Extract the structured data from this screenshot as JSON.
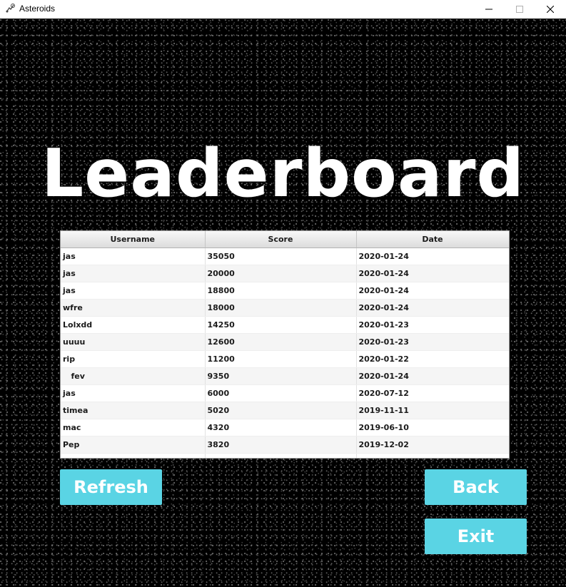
{
  "window": {
    "title": "Asteroids"
  },
  "heading": "Leaderboard",
  "table": {
    "headers": [
      "Username",
      "Score",
      "Date"
    ],
    "rows": [
      [
        "jas",
        "35050",
        "2020-01-24"
      ],
      [
        "jas",
        "20000",
        "2020-01-24"
      ],
      [
        "jas",
        "18800",
        "2020-01-24"
      ],
      [
        "wfre",
        "18000",
        "2020-01-24"
      ],
      [
        "Lolxdd",
        "14250",
        "2020-01-23"
      ],
      [
        "uuuu",
        "12600",
        "2020-01-23"
      ],
      [
        "rip",
        "11200",
        "2020-01-22"
      ],
      [
        "   fev",
        "9350",
        "2020-01-24"
      ],
      [
        "jas",
        "6000",
        "2020-07-12"
      ],
      [
        "timea",
        "5020",
        "2019-11-11"
      ],
      [
        "mac",
        "4320",
        "2019-06-10"
      ],
      [
        "Pep",
        "3820",
        "2019-12-02"
      ],
      [
        "",
        "",
        ""
      ]
    ]
  },
  "buttons": {
    "refresh": "Refresh",
    "back": "Back",
    "exit": "Exit"
  },
  "colors": {
    "accent": "#5ad4e4",
    "background": "#000000",
    "text": "#ffffff"
  }
}
